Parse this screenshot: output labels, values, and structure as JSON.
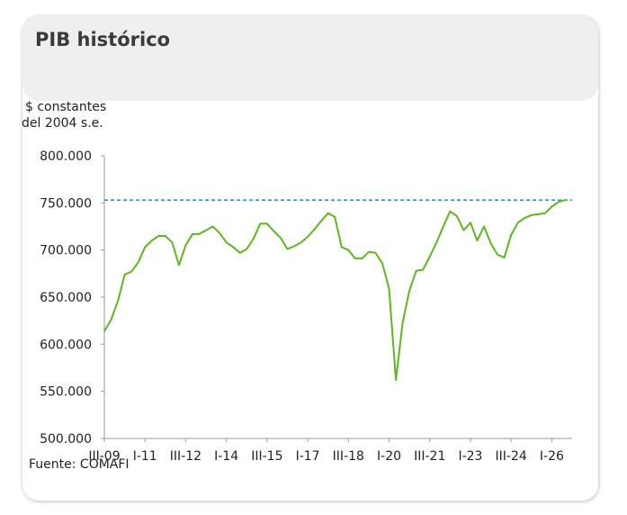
{
  "header": {
    "title": "PIB histórico"
  },
  "chart_data": {
    "type": "line",
    "title": "PIB histórico",
    "ylabel_lines": [
      "$ constantes",
      "del 2004 s.e."
    ],
    "ylim": [
      500000,
      800000
    ],
    "yticks": [
      500000,
      550000,
      600000,
      650000,
      700000,
      750000,
      800000
    ],
    "ytick_labels": [
      "500.000",
      "550.000",
      "600.000",
      "650.000",
      "700.000",
      "750.000",
      "800.000"
    ],
    "x_start_index": 0,
    "x_end_index": 69,
    "xtick_positions": [
      0,
      6,
      12,
      18,
      24,
      30,
      36,
      42,
      48,
      54,
      60,
      66
    ],
    "xtick_labels": [
      "III-09",
      "I-11",
      "III-12",
      "I-14",
      "III-15",
      "I-17",
      "III-18",
      "I-20",
      "III-21",
      "I-23",
      "III-24",
      "I-26"
    ],
    "reference_line": {
      "value": 753000,
      "style": "dashed",
      "color": "#1a7fc4"
    },
    "series": [
      {
        "color": "#5cb81e",
        "values": [
          614000,
          626000,
          646000,
          674000,
          677000,
          687000,
          703000,
          710000,
          715000,
          715000,
          708000,
          684000,
          705000,
          717000,
          717000,
          721000,
          725000,
          718000,
          708000,
          703000,
          697000,
          701000,
          712000,
          728000,
          728000,
          720000,
          713000,
          701000,
          704000,
          708000,
          714000,
          722000,
          731000,
          739000,
          735000,
          703000,
          700000,
          691000,
          691000,
          698000,
          697000,
          686000,
          659000,
          562000,
          623000,
          657000,
          678000,
          679000,
          693000,
          708000,
          725000,
          741000,
          736000,
          721000,
          729000,
          710000,
          725000,
          707000,
          695000,
          692000,
          716000,
          729000,
          734000,
          737000,
          738000,
          739000,
          746000,
          751000,
          753000
        ]
      }
    ]
  },
  "footer": {
    "source": "Fuente: COMAFI"
  }
}
